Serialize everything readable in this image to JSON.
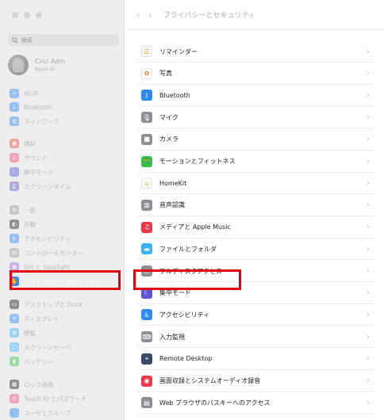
{
  "window": {
    "title": "プライバシーとセキュリティ",
    "back_icon": "‹",
    "forward_icon": "›"
  },
  "search": {
    "placeholder": "検索"
  },
  "account": {
    "name": "Cnci Adm",
    "sub": "Apple ID"
  },
  "sidebar": {
    "items": [
      {
        "label": "Wi-Fi",
        "icon": "wifi-icon",
        "color": "#2f8af5",
        "glyph": "≈"
      },
      {
        "label": "Bluetooth",
        "icon": "bluetooth-icon",
        "color": "#2f8af5",
        "glyph": "ᛒ"
      },
      {
        "label": "ネットワーク",
        "icon": "network-icon",
        "color": "#2f8af5",
        "glyph": "◍"
      },
      {
        "label": "通知",
        "icon": "notifications-icon",
        "color": "#f04a3e",
        "glyph": "▣"
      },
      {
        "label": "サウンド",
        "icon": "sound-icon",
        "color": "#f04a7a",
        "glyph": "♪"
      },
      {
        "label": "集中モード",
        "icon": "focus-icon",
        "color": "#5b55d6",
        "glyph": "☾"
      },
      {
        "label": "スクリーンタイム",
        "icon": "screentime-icon",
        "color": "#5b55d6",
        "glyph": "⌛"
      },
      {
        "label": "一般",
        "icon": "general-icon",
        "color": "#9a9a9a",
        "glyph": "⚙"
      },
      {
        "label": "外観",
        "icon": "appearance-icon",
        "color": "#1e1e1e",
        "glyph": "◐"
      },
      {
        "label": "アクセシビリティ",
        "icon": "accessibility-icon",
        "color": "#2f8af5",
        "glyph": "♿"
      },
      {
        "label": "コントロールセンター",
        "icon": "control-center-icon",
        "color": "#9a9a9a",
        "glyph": "▤"
      },
      {
        "label": "Siri と Spotlight",
        "icon": "siri-icon",
        "color": "#a26ad8",
        "glyph": "◉"
      },
      {
        "label": "プライバシーとセキュリティ",
        "icon": "privacy-hand-icon",
        "color": "#2f8af5",
        "glyph": "✋",
        "selected": true
      },
      {
        "label": "デスクトップと Dock",
        "icon": "dock-icon",
        "color": "#1e1e1e",
        "glyph": "▭"
      },
      {
        "label": "ディスプレイ",
        "icon": "display-icon",
        "color": "#2f8af5",
        "glyph": "☀"
      },
      {
        "label": "壁紙",
        "icon": "wallpaper-icon",
        "color": "#3ab4f0",
        "glyph": "❀"
      },
      {
        "label": "スクリーンセーバ",
        "icon": "screensaver-icon",
        "color": "#3ab4f0",
        "glyph": "▢"
      },
      {
        "label": "バッテリー",
        "icon": "battery-icon",
        "color": "#35c24a",
        "glyph": "▮"
      },
      {
        "label": "ロック画面",
        "icon": "lock-screen-icon",
        "color": "#1e1e1e",
        "glyph": "▦"
      },
      {
        "label": "Touch ID とパスワード",
        "icon": "touchid-icon",
        "color": "#f04a7a",
        "glyph": "◎"
      },
      {
        "label": "ユーザとグループ",
        "icon": "users-icon",
        "color": "#2f8af5",
        "glyph": "👥"
      }
    ]
  },
  "main": {
    "rows": [
      {
        "label": "リマインダー",
        "icon": "reminders-icon",
        "color": "#ffffff",
        "glyph": "☰",
        "glyph_color": "#f09a2e",
        "border": true
      },
      {
        "label": "写真",
        "icon": "photos-icon",
        "color": "#ffffff",
        "glyph": "✿",
        "glyph_color": "#f07a2e"
      },
      {
        "label": "Bluetooth",
        "icon": "bluetooth-icon",
        "color": "#2f8af5",
        "glyph": "ᛒ"
      },
      {
        "label": "マイク",
        "icon": "microphone-icon",
        "color": "#8e8e93",
        "glyph": "🎙"
      },
      {
        "label": "カメラ",
        "icon": "camera-icon",
        "color": "#8e8e93",
        "glyph": "■"
      },
      {
        "label": "モーションとフィットネス",
        "icon": "motion-icon",
        "color": "#35c24a",
        "glyph": "🏃"
      },
      {
        "label": "HomeKit",
        "icon": "homekit-icon",
        "color": "#ffffff",
        "glyph": "⌂",
        "glyph_color": "#f0a030"
      },
      {
        "label": "音声認識",
        "icon": "speech-recognition-icon",
        "color": "#8e8e93",
        "glyph": "▥"
      },
      {
        "label": "メディアと Apple Music",
        "icon": "music-icon",
        "color": "#f0384a",
        "glyph": "♫"
      },
      {
        "label": "ファイルとフォルダ",
        "icon": "folder-icon",
        "color": "#3ab4f0",
        "glyph": "▬"
      },
      {
        "label": "フルディスクアクセス",
        "icon": "disk-icon",
        "color": "#8e8e93",
        "glyph": "▭"
      },
      {
        "label": "集中モード",
        "icon": "focus-icon",
        "color": "#5b55d6",
        "glyph": "☾"
      },
      {
        "label": "アクセシビリティ",
        "icon": "accessibility-icon",
        "color": "#2f8af5",
        "glyph": "♿"
      },
      {
        "label": "入力監視",
        "icon": "keyboard-icon",
        "color": "#8e8e93",
        "glyph": "⌨"
      },
      {
        "label": "Remote Desktop",
        "icon": "remote-desktop-icon",
        "color": "#3a4a6a",
        "glyph": "⌖"
      },
      {
        "label": "画面収録とシステムオーディオ録音",
        "icon": "screen-recording-icon",
        "color": "#f0384a",
        "glyph": "◉"
      },
      {
        "label": "Web ブラウザのパスキーへのアクセス",
        "icon": "passkey-icon",
        "color": "#8e8e93",
        "glyph": "▤"
      }
    ],
    "chevron": "›"
  }
}
